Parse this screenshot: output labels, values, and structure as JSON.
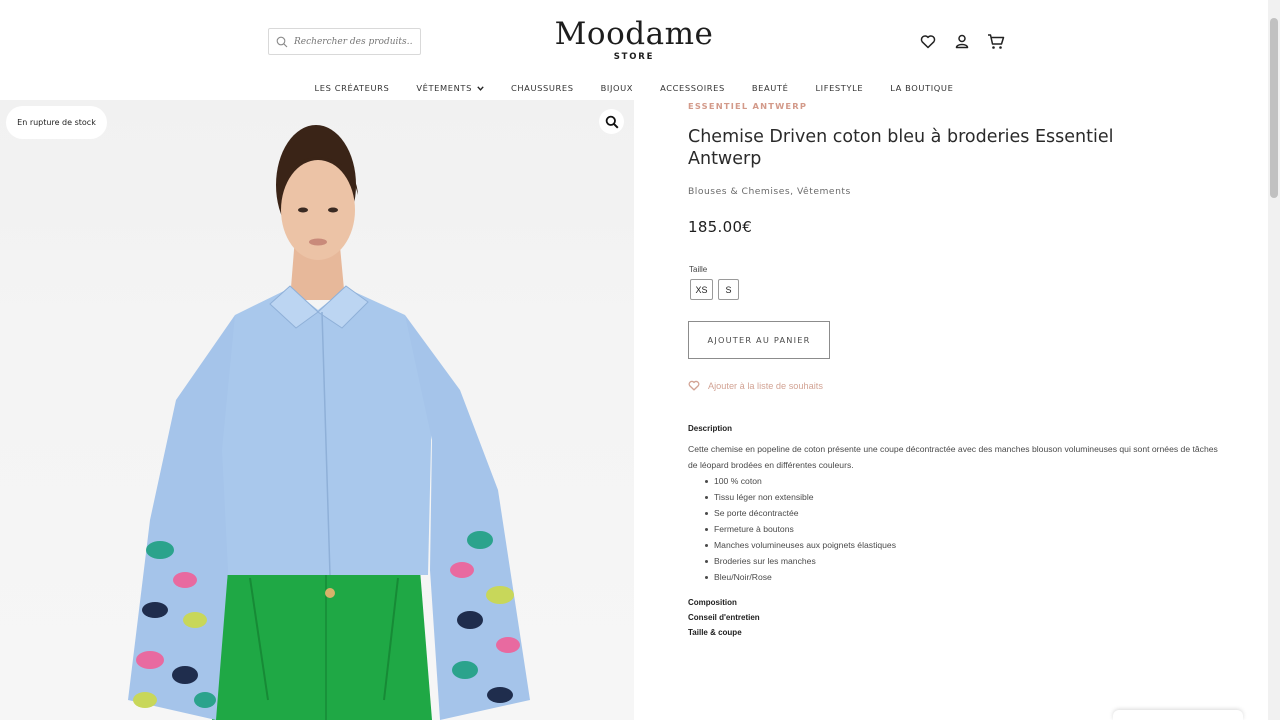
{
  "header": {
    "search_placeholder": "Rechercher des produits…",
    "logo_title": "Moodame",
    "logo_sub": "STORE",
    "icons": [
      "heart-icon",
      "user-icon",
      "cart-icon"
    ]
  },
  "nav": {
    "items": [
      {
        "label": "LES CRÉATEURS"
      },
      {
        "label": "VÊTEMENTS",
        "has_dropdown": true
      },
      {
        "label": "CHAUSSURES"
      },
      {
        "label": "BIJOUX"
      },
      {
        "label": "ACCESSOIRES"
      },
      {
        "label": "BEAUTÉ"
      },
      {
        "label": "LIFESTYLE"
      },
      {
        "label": "LA BOUTIQUE"
      }
    ]
  },
  "gallery": {
    "badge": "En rupture de stock",
    "zoom_icon": "search-icon"
  },
  "product": {
    "brand": "ESSENTIEL ANTWERP",
    "title": "Chemise Driven coton bleu à broderies Essentiel Antwerp",
    "categories": "Blouses & Chemises, Vêtements",
    "price": "185.00€",
    "size_label": "Taille",
    "sizes": [
      "XS",
      "S"
    ],
    "cart_button": "AJOUTER AU PANIER",
    "wishlist": "Ajouter à la liste de souhaits",
    "description_heading": "Description",
    "description_text": "Cette chemise en popeline de coton présente une coupe décontractée avec des manches blouson volumineuses qui sont ornées de tâches de léopard brodées en différentes couleurs.",
    "features": [
      "100 % coton",
      "Tissu léger non extensible",
      "Se porte décontractée",
      "Fermeture à boutons",
      "Manches volumineuses aux poignets élastiques",
      "Broderies sur les manches",
      "Bleu/Noir/Rose"
    ],
    "sections": [
      "Composition",
      "Conseil d'entretien",
      "Taille & coupe"
    ]
  },
  "colors": {
    "brand_accent": "#d39a8a",
    "shirt": "#a9c8ec",
    "trousers": "#22a94a"
  }
}
